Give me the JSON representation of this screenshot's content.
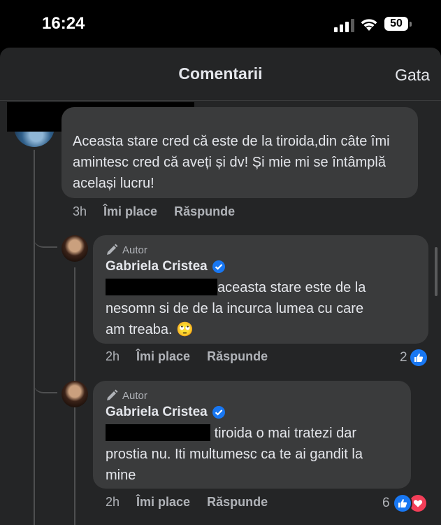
{
  "status_bar": {
    "time": "16:24",
    "battery": "50"
  },
  "header": {
    "title": "Comentarii",
    "done_label": "Gata"
  },
  "comments": [
    {
      "text": "Aceasta stare cred că este de la tiroida,din câte îmi amintesc cred că aveți și dv! Și mie mi se întâmplă același lucru!",
      "time": "3h",
      "like_label": "Îmi place",
      "reply_label": "Răspunde"
    },
    {
      "author_badge": "Autor",
      "author_name": "Gabriela Cristea",
      "text_line1": "aceasta stare este de la",
      "text_line2": "nesomn si de de la incurca lumea cu care",
      "text_line3": "am treaba.",
      "emoji": "🙄",
      "time": "2h",
      "like_label": "Îmi place",
      "reply_label": "Răspunde",
      "reaction_count": "2"
    },
    {
      "author_badge": "Autor",
      "author_name": "Gabriela Cristea",
      "text_line1": "tiroida o mai tratezi dar",
      "text_line2": "prostia nu. Iti multumesc ca te ai gandit la",
      "text_line3": "mine",
      "time": "2h",
      "like_label": "Îmi place",
      "reply_label": "Răspunde",
      "reaction_count": "6"
    }
  ],
  "colors": {
    "sheet_bg": "#242526",
    "bubble_bg": "#3a3b3c",
    "like_blue": "#1877f2",
    "love_red": "#f33e58"
  }
}
